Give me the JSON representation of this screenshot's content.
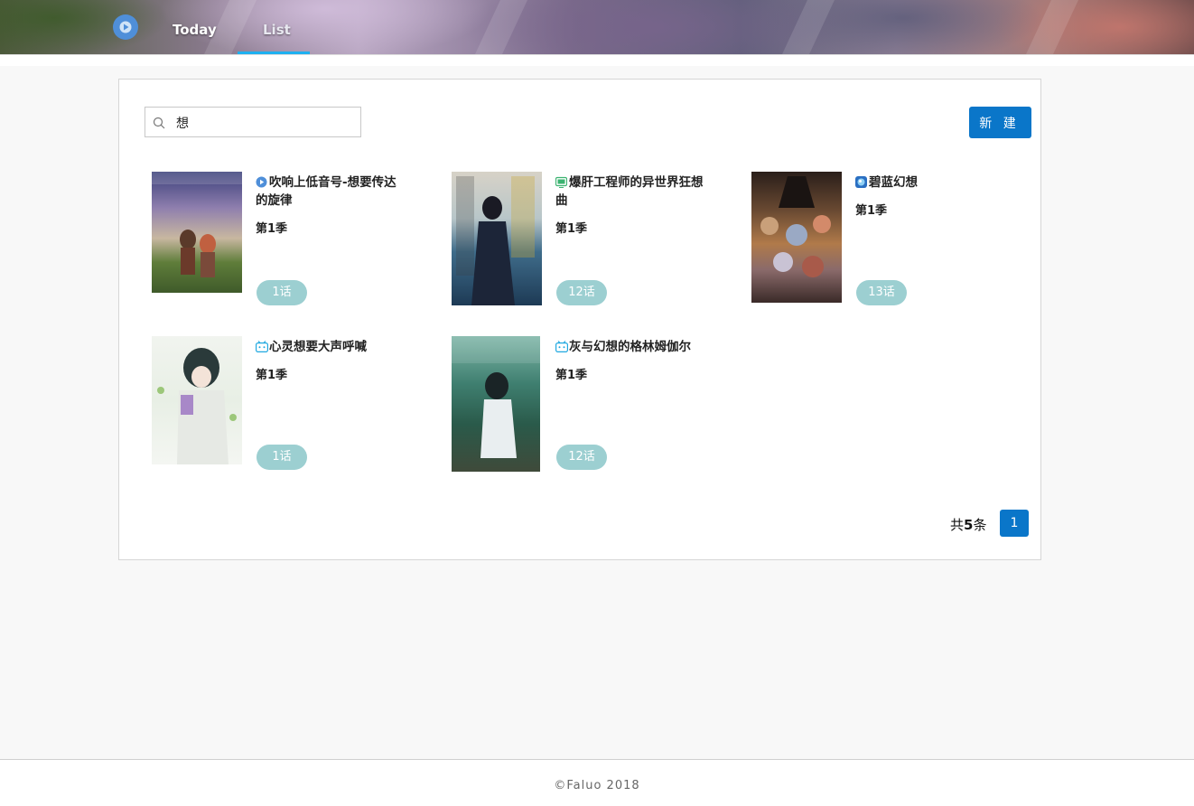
{
  "header": {
    "tabs": [
      {
        "label": "Today",
        "active": false
      },
      {
        "label": "List",
        "active": true
      }
    ],
    "accent_color": "#1eb0f0"
  },
  "search": {
    "value": "想",
    "placeholder": ""
  },
  "new_button": {
    "label": "新 建",
    "color": "#0a76c9"
  },
  "items": [
    {
      "title": "吹响上低音号-想要传达的旋律",
      "season": "第1季",
      "episodes": "1话",
      "source_icon": "play-circle-icon"
    },
    {
      "title": "爆肝工程师的异世界狂想曲",
      "season": "第1季",
      "episodes": "12话",
      "source_icon": "tv-icon"
    },
    {
      "title": "碧蓝幻想",
      "season": "第1季",
      "episodes": "13话",
      "source_icon": "blue-sphere-icon"
    },
    {
      "title": "心灵想要大声呼喊",
      "season": "第1季",
      "episodes": "1话",
      "source_icon": "bilibili-icon"
    },
    {
      "title": "灰与幻想的格林姆伽尔",
      "season": "第1季",
      "episodes": "12话",
      "source_icon": "bilibili-icon"
    }
  ],
  "pagination": {
    "total_prefix": "共",
    "total_count": "5",
    "total_suffix": "条",
    "current_page": "1"
  },
  "footer": {
    "text": "©Faluo 2018"
  }
}
